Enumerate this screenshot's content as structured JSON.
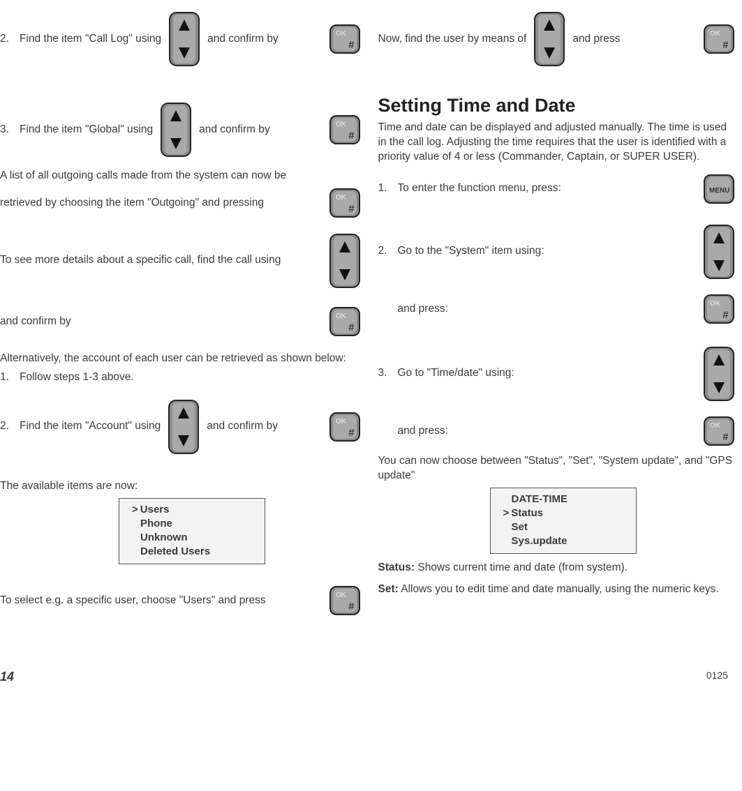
{
  "left": {
    "step2a": {
      "prefix": "2.",
      "t1": "Find the item \"Call Log\" using",
      "t2": "and confirm by"
    },
    "step3a": {
      "prefix": "3.",
      "t1": "Find the item \"Global\" using",
      "t2": "and confirm by"
    },
    "list_intro": "A list of all outgoing calls made from the system can now be",
    "retrieved": "retrieved by choosing the item \"Outgoing\" and pressing",
    "details": "To see more details about a specific call, find the call using",
    "confirm": "and confirm by",
    "alt": "Alternatively, the account of each user can be retrieved as shown below:",
    "step1b": {
      "prefix": "1.",
      "t": "Follow steps 1-3 above."
    },
    "step2b": {
      "prefix": "2.",
      "t1": "Find the item \"Account\" using",
      "t2": "and confirm by"
    },
    "available": "The available items are now:",
    "menu": [
      "Users",
      "Phone",
      "Unknown",
      "Deleted Users"
    ],
    "select_user": "To select e.g. a specific user, choose \"Users\" and press"
  },
  "right": {
    "now_find": {
      "t1": "Now, find the user by means of",
      "t2": "and press"
    },
    "h2": "Setting Time and Date",
    "intro": "Time and date can be displayed and adjusted manually. The time is used in the call log. Adjusting the time requires that the user is identified with a priority value of 4 or less (Commander, Captain, or SUPER USER).",
    "s1": {
      "prefix": "1.",
      "t": "To enter the function menu, press:"
    },
    "s2": {
      "prefix": "2.",
      "t": "Go to the \"System\" item using:"
    },
    "and_press": "and press:",
    "s3": {
      "prefix": "3.",
      "t": "Go to \"Time/date\" using:"
    },
    "choose": "You can now choose between \"Status\", \"Set\", \"System update\", and \"GPS update\"",
    "menu_title": "DATE-TIME",
    "menu": [
      "Status",
      "Set",
      "Sys.update"
    ],
    "status_lbl": "Status:",
    "status_txt": " Shows current time and date (from system).",
    "set_lbl": "Set:",
    "set_txt": " Allows you to edit time and date manually, using the numeric keys."
  },
  "footer": {
    "page": "14",
    "code": "0125"
  }
}
